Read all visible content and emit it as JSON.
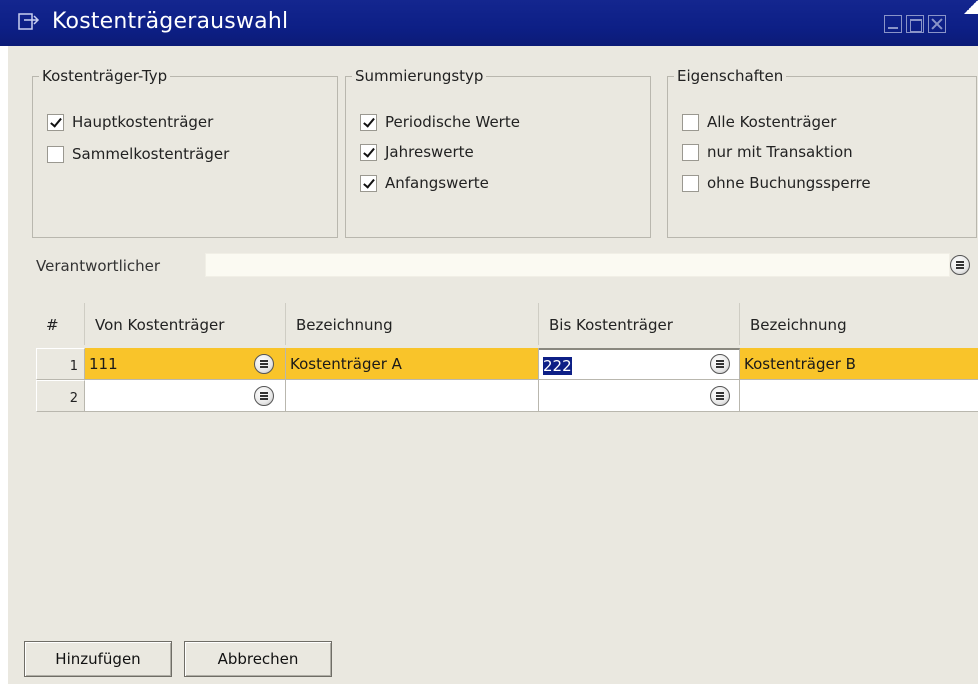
{
  "window": {
    "title": "Kostenträgerauswahl"
  },
  "groups": {
    "type": {
      "legend": "Kostenträger-Typ",
      "options": [
        {
          "label": "Hauptkostenträger",
          "checked": true
        },
        {
          "label": "Sammelkostenträger",
          "checked": false
        }
      ]
    },
    "summation": {
      "legend": "Summierungstyp",
      "options": [
        {
          "label": "Periodische Werte",
          "checked": true
        },
        {
          "label": "Jahreswerte",
          "checked": true
        },
        {
          "label": "Anfangswerte",
          "checked": true
        }
      ]
    },
    "properties": {
      "legend": "Eigenschaften",
      "options": [
        {
          "label": "Alle Kostenträger",
          "checked": false
        },
        {
          "label": "nur mit Transaktion",
          "checked": false
        },
        {
          "label": "ohne Buchungssperre",
          "checked": false
        }
      ]
    }
  },
  "responsible": {
    "label": "Verantwortlicher",
    "value": ""
  },
  "table": {
    "headers": [
      "#",
      "Von Kostenträger",
      "Bezeichnung",
      "Bis Kostenträger",
      "Bezeichnung"
    ],
    "rows": [
      {
        "num": "1",
        "from": "111",
        "from_desc": "Kostenträger A",
        "to": "222",
        "to_desc": "Kostenträger B",
        "selected": true
      },
      {
        "num": "2",
        "from": "",
        "from_desc": "",
        "to": "",
        "to_desc": "",
        "selected": false
      }
    ]
  },
  "buttons": {
    "add": "Hinzufügen",
    "cancel": "Abbrechen"
  },
  "colors": {
    "titlebar": "#0d1f86",
    "selected_row": "#f9c42a",
    "window_bg": "#eae8e0"
  },
  "icons": {
    "window": "form-icon",
    "pick": "list-picker-icon"
  }
}
